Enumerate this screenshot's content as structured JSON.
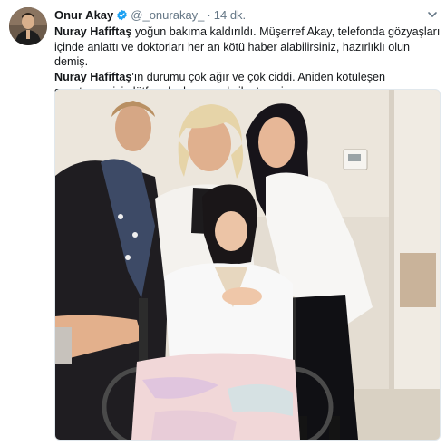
{
  "tweet": {
    "display_name": "Onur Akay",
    "handle": "@_onurakay_",
    "separator": "·",
    "timestamp": "14 dk.",
    "text": {
      "p1_bold": "Nuray Hafiftaş",
      "p1_rest": " yoğun bakıma kaldırıldı. Müşerref Akay, telefonda gözyaşları içinde anlattı ve doktorları her an kötü haber alabilirsiniz, hazırlıklı olun demiş.",
      "p2_bold": "Nuray Hafiftaş",
      "p2_rest": "'ın durumu çok ağır ve çok ciddi. Aniden kötüleşen sanatçımız için lütfen dualarınızı eksik etmeyin."
    },
    "icons": {
      "verified": "verified-badge-icon",
      "caret": "chevron-down-icon"
    },
    "colors": {
      "verified": "#1da1f2",
      "secondary_text": "#657786",
      "primary_text": "#14171a"
    }
  }
}
